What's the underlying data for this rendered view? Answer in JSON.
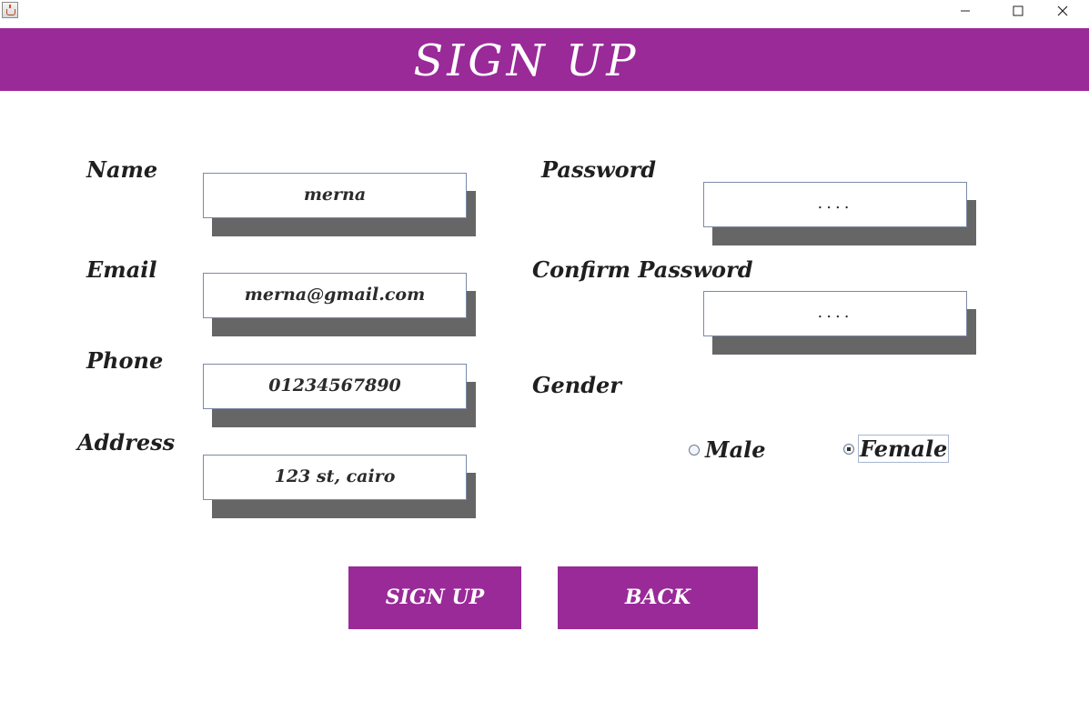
{
  "window": {
    "icon": "java-cup-icon",
    "controls": [
      "minimize-icon",
      "maximize-icon",
      "close-icon"
    ]
  },
  "header": {
    "title": "SIGN UP",
    "color": "#992a98"
  },
  "form": {
    "name": {
      "label": "Name",
      "value": "merna"
    },
    "email": {
      "label": "Email",
      "value": "merna@gmail.com"
    },
    "phone": {
      "label": "Phone",
      "value": "01234567890"
    },
    "address": {
      "label": "Address",
      "value": "123 st, cairo"
    },
    "password": {
      "label": "Password",
      "value": "...."
    },
    "confirm_password": {
      "label": "Confirm Password",
      "value": "...."
    },
    "gender": {
      "label": "Gender",
      "options": [
        {
          "label": "Male",
          "selected": false
        },
        {
          "label": "Female",
          "selected": true
        }
      ]
    }
  },
  "actions": {
    "signup_label": "SIGN UP",
    "back_label": "BACK"
  }
}
